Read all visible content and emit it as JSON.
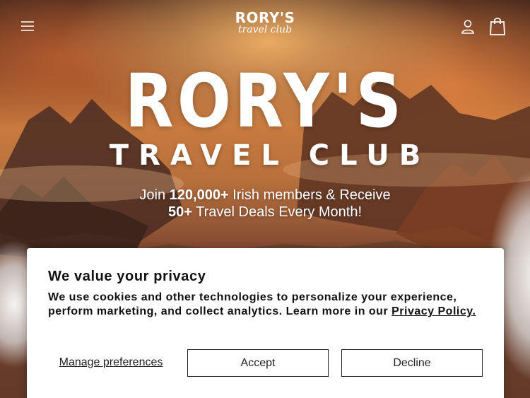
{
  "header": {
    "logo_top": "RORY'S",
    "logo_bottom": "travel club",
    "icons": [
      "menu-icon",
      "account-icon",
      "cart-icon"
    ]
  },
  "hero": {
    "title": "RORY'S",
    "subtitle": "TRAVEL CLUB",
    "tagline_1": "Join ",
    "tagline_members": "120,000+",
    "tagline_2": " Irish members & Receive ",
    "tagline_deals": "50+",
    "tagline_3": " Travel Deals Every Month!"
  },
  "consent": {
    "title": "We value your privacy",
    "body": "We use cookies and other technologies to personalize your experience, perform marketing, and collect analytics. Learn more in our ",
    "link": "Privacy Policy.",
    "manage_label": "Manage preferences",
    "accept_label": "Accept",
    "decline_label": "Decline"
  },
  "colors": {
    "text_on_hero": "#ffffff",
    "dialog_bg": "#ffffff",
    "dialog_text": "#111111"
  }
}
